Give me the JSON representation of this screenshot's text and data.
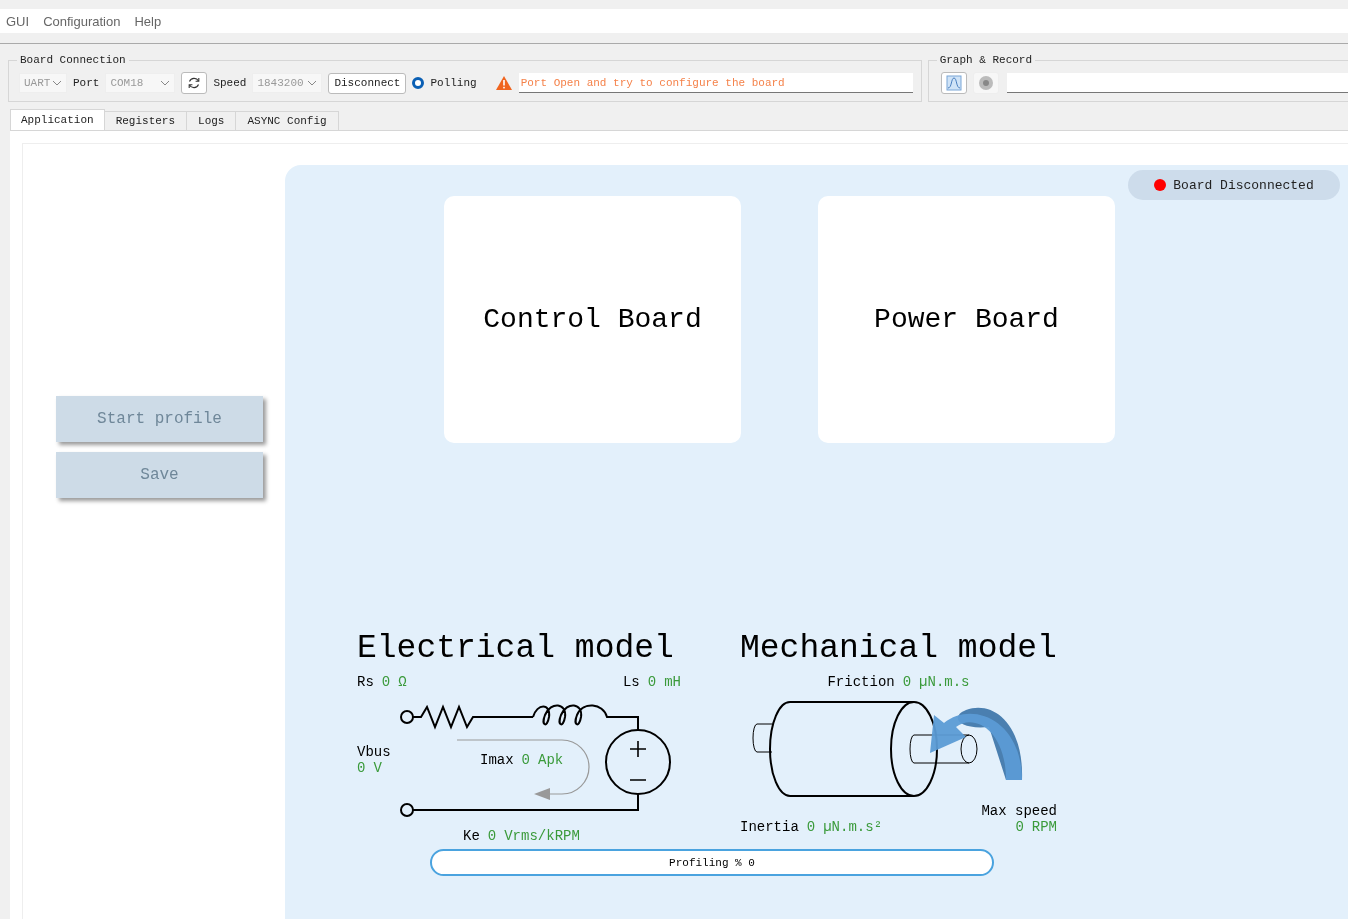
{
  "menu": [
    {
      "label": "GUI"
    },
    {
      "label": "Configuration"
    },
    {
      "label": "Help"
    }
  ],
  "board_connection": {
    "title": "Board Connection",
    "interface": {
      "value": "UART",
      "disabled": true
    },
    "port_label": "Port",
    "port": {
      "value": "COM18",
      "disabled": true
    },
    "speed_label": "Speed",
    "speed": {
      "value": "1843200",
      "disabled": true
    },
    "disconnect_button": "Disconnect",
    "polling": {
      "label": "Polling",
      "selected": true
    },
    "message": "Port Open and try to configure the board"
  },
  "graph_record": {
    "title": "Graph & Record",
    "record": {
      "disabled": true
    }
  },
  "tabs": [
    {
      "label": "Application",
      "selected": true
    },
    {
      "label": "Registers",
      "selected": false
    },
    {
      "label": "Logs",
      "selected": false
    },
    {
      "label": "ASYNC Config",
      "selected": false
    }
  ],
  "buttons": [
    {
      "label": "Start profile",
      "disabled": true
    },
    {
      "label": "Save",
      "disabled": true
    }
  ],
  "status": {
    "label": "Board Disconnected",
    "color": "#ff0000"
  },
  "boards": [
    {
      "label": "Control Board"
    },
    {
      "label": "Power Board"
    }
  ],
  "electrical": {
    "title": "Electrical model",
    "rs": {
      "label": "Rs",
      "value": "0",
      "unit": "Ω"
    },
    "ls": {
      "label": "Ls",
      "value": "0",
      "unit": "mH"
    },
    "vbus": {
      "label": "Vbus",
      "value": "0",
      "unit": "V"
    },
    "imax": {
      "label": "Imax",
      "value": "0",
      "unit": "Apk"
    },
    "ke": {
      "label": "Ke",
      "value": "0",
      "unit": "Vrms/kRPM"
    }
  },
  "mechanical": {
    "title": "Mechanical model",
    "friction": {
      "label": "Friction",
      "value": "0",
      "unit": "µN.m.s"
    },
    "inertia": {
      "label": "Inertia",
      "value": "0",
      "unit": "µN.m.s²"
    },
    "max_speed": {
      "label": "Max speed",
      "value": "0",
      "unit": "RPM"
    }
  },
  "progress": {
    "label": "Profiling % 0",
    "level": 0
  }
}
